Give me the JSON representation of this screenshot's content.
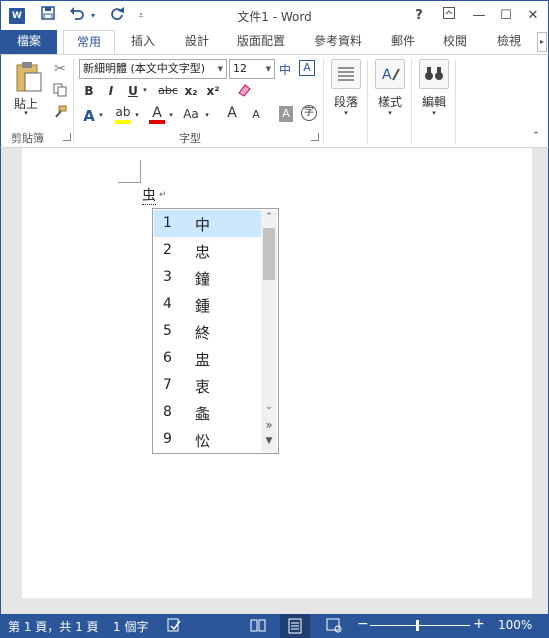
{
  "window": {
    "title": "文件1 - Word",
    "app_icon_label": "W",
    "help": "?",
    "ribbon_display": "⊼",
    "minimize": "—",
    "maximize": "☐",
    "close": "✕"
  },
  "qat": {
    "save_icon": "save-icon",
    "undo_icon": "undo-icon",
    "redo_icon": "redo-icon",
    "customize_icon": "customize-qat-icon"
  },
  "tabs": [
    {
      "label": "檔案"
    },
    {
      "label": "常用"
    },
    {
      "label": "插入"
    },
    {
      "label": "設計"
    },
    {
      "label": "版面配置"
    },
    {
      "label": "參考資料"
    },
    {
      "label": "郵件"
    },
    {
      "label": "校閱"
    },
    {
      "label": "檢視"
    }
  ],
  "ribbon": {
    "clipboard": {
      "paste_label": "貼上",
      "group_label": "剪貼簿"
    },
    "font": {
      "font_name": "新細明體 (本文中文字型)",
      "font_size": "12",
      "group_label": "字型",
      "bold": "B",
      "italic": "I",
      "underline": "U",
      "strikethrough": "abc",
      "subscript": "x₂",
      "superscript": "x²",
      "grow_font": "A",
      "shrink_font": "A",
      "change_case": "Aa",
      "char_shading": "A",
      "phonetic_guide": "中",
      "enclose_char": "字",
      "char_border": "A"
    },
    "paragraph_label": "段落",
    "styles_label": "樣式",
    "editing_label": "編輯"
  },
  "document": {
    "typed_text": "虫",
    "para_mark": "↵"
  },
  "candidates": {
    "items": [
      {
        "num": "1",
        "char": "中"
      },
      {
        "num": "2",
        "char": "忠"
      },
      {
        "num": "3",
        "char": "鐘"
      },
      {
        "num": "4",
        "char": "鍾"
      },
      {
        "num": "5",
        "char": "終"
      },
      {
        "num": "6",
        "char": "盅"
      },
      {
        "num": "7",
        "char": "衷"
      },
      {
        "num": "8",
        "char": "螽"
      },
      {
        "num": "9",
        "char": "忪"
      }
    ],
    "selected_index": 0,
    "expand_glyph": "»"
  },
  "status": {
    "page": "第 1 頁，共 1 頁",
    "words": "1 個字",
    "zoom": "100%",
    "zoom_minus": "−",
    "zoom_plus": "+"
  },
  "colors": {
    "accent": "#2b579a",
    "selection": "#cce8ff",
    "highlight": "#ffff00",
    "font_color": "#e00000"
  }
}
